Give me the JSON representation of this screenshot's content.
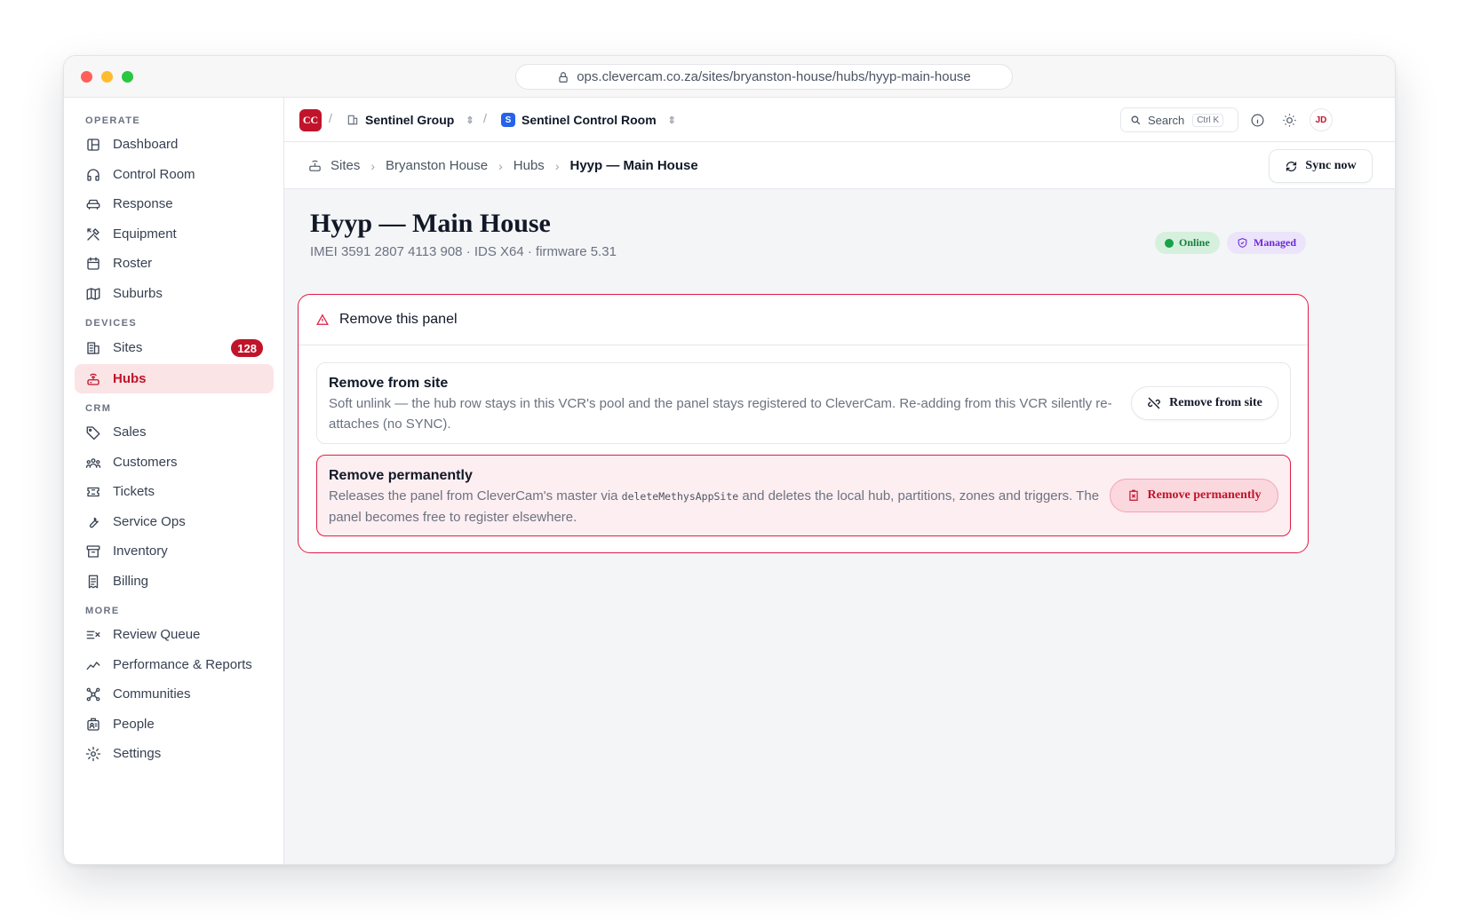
{
  "browser": {
    "url": "ops.clevercam.co.za/sites/bryanston-house/hubs/hyyp-main-house"
  },
  "sidebar": {
    "sections": {
      "operate": "OPERATE",
      "devices": "DEVICES",
      "crm": "CRM",
      "more": "MORE"
    },
    "items": [
      {
        "label": "Dashboard",
        "icon": "layout-icon"
      },
      {
        "label": "Control Room",
        "icon": "headset-icon"
      },
      {
        "label": "Response",
        "icon": "car-icon"
      },
      {
        "label": "Equipment",
        "icon": "tools-icon"
      },
      {
        "label": "Roster",
        "icon": "calendar-icon"
      },
      {
        "label": "Suburbs",
        "icon": "map-icon"
      },
      {
        "label": "Sites",
        "icon": "building-icon",
        "badge": "128"
      },
      {
        "label": "Hubs",
        "icon": "router-icon",
        "active": true
      },
      {
        "label": "Sales",
        "icon": "tag-icon"
      },
      {
        "label": "Customers",
        "icon": "users-icon"
      },
      {
        "label": "Tickets",
        "icon": "ticket-icon"
      },
      {
        "label": "Service Ops",
        "icon": "wrench-icon"
      },
      {
        "label": "Inventory",
        "icon": "archive-icon"
      },
      {
        "label": "Billing",
        "icon": "receipt-icon"
      },
      {
        "label": "Review Queue",
        "icon": "list-check-icon"
      },
      {
        "label": "Performance & Reports",
        "icon": "trend-icon"
      },
      {
        "label": "Communities",
        "icon": "network-icon"
      },
      {
        "label": "People",
        "icon": "id-badge-icon"
      },
      {
        "label": "Settings",
        "icon": "gear-icon"
      }
    ]
  },
  "topbar": {
    "org_logo": "CC",
    "org_name": "Sentinel Group",
    "room_badge": "S",
    "room_name": "Sentinel Control Room",
    "search_label": "Search",
    "search_shortcut": "Ctrl K",
    "avatar": "JD"
  },
  "breadcrumb": {
    "items": [
      "Sites",
      "Bryanston House",
      "Hubs"
    ],
    "current": "Hyyp — Main House",
    "sync_label": "Sync now"
  },
  "page": {
    "title": "Hyyp — Main House",
    "subtitle": "IMEI 3591 2807 4113 908 · IDS X64 · firmware 5.31",
    "status_online": "Online",
    "status_managed": "Managed",
    "colors": {
      "danger": "#e11d48",
      "online": "#16a34a",
      "managed": "#6d28d9",
      "brand": "#c0142b"
    }
  },
  "danger_zone": {
    "title": "Remove this panel",
    "remove_site": {
      "title": "Remove from site",
      "description": "Soft unlink — the hub row stays in this VCR's pool and the panel stays registered to CleverCam. Re-adding from this VCR silently re-attaches (no SYNC).",
      "button": "Remove from site"
    },
    "remove_permanent": {
      "title": "Remove permanently",
      "desc_before": "Releases the panel from CleverCam's master via ",
      "desc_code": "deleteMethysAppSite",
      "desc_after": " and deletes the local hub, partitions, zones and triggers. The panel becomes free to register elsewhere.",
      "button": "Remove permanently"
    }
  }
}
